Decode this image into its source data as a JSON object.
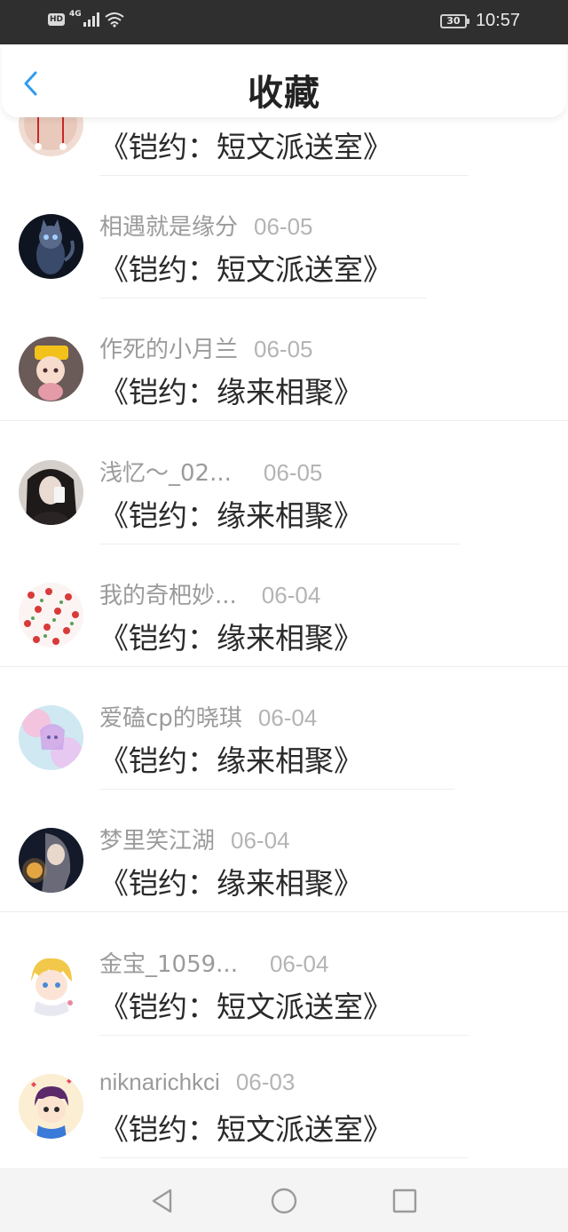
{
  "status_bar": {
    "hd": "HD",
    "network": "4G",
    "battery": "30",
    "time": "10:57"
  },
  "header": {
    "title": "收藏",
    "back_icon": "chevron-left-icon",
    "accent_color": "#2f9bf0"
  },
  "items": [
    {
      "name": "",
      "date": "",
      "content": "《铠约：短文派送室》",
      "avatar": "red-pendant"
    },
    {
      "name": "相遇就是缘分",
      "date": "06-05",
      "content": "《铠约：短文派送室》",
      "avatar": "blue-cat"
    },
    {
      "name": "作死的小月兰",
      "date": "06-05",
      "content": "《铠约：缘来相聚》",
      "avatar": "chibi-yellow-hat"
    },
    {
      "name": "浅忆～_02...",
      "date": "06-05",
      "content": "《铠约：缘来相聚》",
      "avatar": "girl-selfie"
    },
    {
      "name": "我的奇杷妙...",
      "date": "06-04",
      "content": "《铠约：缘来相聚》",
      "avatar": "strawberry-pattern"
    },
    {
      "name": "爱磕cp的晓琪",
      "date": "06-04",
      "content": "《铠约：缘来相聚》",
      "avatar": "pastel-anime"
    },
    {
      "name": "梦里笑江湖",
      "date": "06-04",
      "content": "《铠约：缘来相聚》",
      "avatar": "dark-anime-lantern"
    },
    {
      "name": "金宝_1059...",
      "date": "06-04",
      "content": "《铠约：短文派送室》",
      "avatar": "blonde-anime-boy"
    },
    {
      "name": "niknarichkci",
      "date": "06-03",
      "content": "《铠约：短文派送室》",
      "avatar": "cartoon-boy"
    }
  ],
  "nav_bar": {
    "back": "triangle-back-icon",
    "home": "circle-home-icon",
    "recents": "square-recents-icon"
  }
}
